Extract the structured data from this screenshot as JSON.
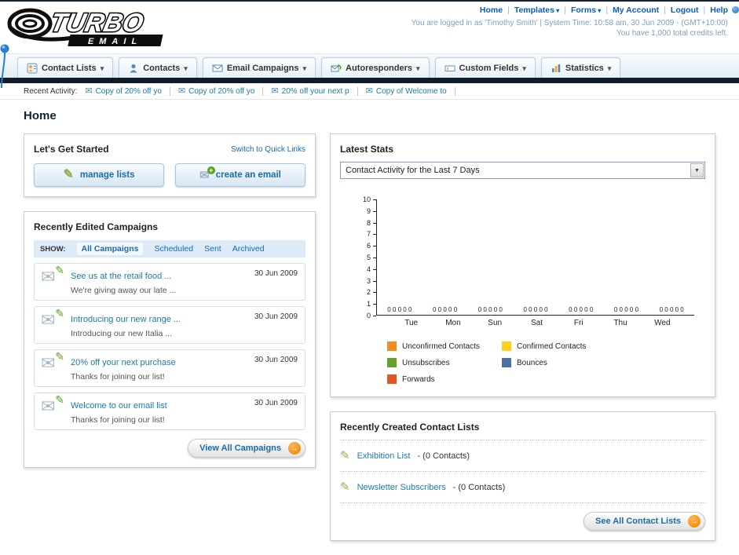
{
  "header": {
    "nav_links": [
      "Home",
      "Templates",
      "Forms",
      "My Account",
      "Logout",
      "Help"
    ],
    "login_info": "You are logged in as 'Timothy Smith' | System Time: 10:58 am, 30 Jun 2009 - (GMT+10:00)",
    "credits_info": "You have 1,000 total credits left.",
    "logo_main": "TURBO",
    "logo_sub": "EMAIL"
  },
  "main_nav": {
    "items": [
      {
        "label": "Contact Lists"
      },
      {
        "label": "Contacts"
      },
      {
        "label": "Email Campaigns"
      },
      {
        "label": "Autoresponders"
      },
      {
        "label": "Custom Fields"
      },
      {
        "label": "Statistics"
      }
    ]
  },
  "recent_activity": {
    "label": "Recent Activity:",
    "items": [
      "Copy of 20% off yo",
      "Copy of 20% off yo",
      "20% off your next p",
      "Copy of Welcome to"
    ]
  },
  "page_title": "Home",
  "get_started": {
    "title": "Let's Get Started",
    "switch_link": "Switch to Quick Links",
    "buttons": [
      {
        "label": "manage lists"
      },
      {
        "label": "create an email"
      }
    ]
  },
  "campaigns": {
    "title": "Recently Edited Campaigns",
    "show_label": "SHOW:",
    "filters": [
      "All Campaigns",
      "Scheduled",
      "Sent",
      "Archived"
    ],
    "active_filter": "All Campaigns",
    "items": [
      {
        "title": "See us at the retail food ...",
        "subtitle": "We're giving away our late ...",
        "date": "30 Jun 2009"
      },
      {
        "title": "Introducing our new range ...",
        "subtitle": "Introducing our new Italia ...",
        "date": "30 Jun 2009"
      },
      {
        "title": "20% off your next purchase",
        "subtitle": "Thanks for joining our list!",
        "date": "30 Jun 2009"
      },
      {
        "title": "Welcome to our email list",
        "subtitle": "Thanks for joining our list!",
        "date": "30 Jun 2009"
      }
    ],
    "view_all_label": "View All Campaigns"
  },
  "latest_stats": {
    "title": "Latest Stats",
    "dropdown_value": "Contact Activity for the Last 7 Days",
    "chart_data": {
      "type": "bar",
      "categories": [
        "Tue",
        "Mon",
        "Sun",
        "Sat",
        "Fri",
        "Thu",
        "Wed"
      ],
      "series": [
        {
          "name": "Unconfirmed Contacts",
          "color": "#F08C21",
          "values": [
            0,
            0,
            0,
            0,
            0,
            0,
            0
          ]
        },
        {
          "name": "Confirmed Contacts",
          "color": "#FDD020",
          "values": [
            0,
            0,
            0,
            0,
            0,
            0,
            0
          ]
        },
        {
          "name": "Unsubscribes",
          "color": "#63A32A",
          "values": [
            0,
            0,
            0,
            0,
            0,
            0,
            0
          ]
        },
        {
          "name": "Bounces",
          "color": "#4F6FA0",
          "values": [
            0,
            0,
            0,
            0,
            0,
            0,
            0
          ]
        },
        {
          "name": "Forwards",
          "color": "#E2571F",
          "values": [
            0,
            0,
            0,
            0,
            0,
            0,
            0
          ]
        }
      ],
      "title": "Contact Activity for the Last 7 Days",
      "xlabel": "",
      "ylabel": "",
      "ylim": [
        0,
        10
      ],
      "grid": false,
      "legend_position": "bottom"
    }
  },
  "contact_lists": {
    "title": "Recently Created Contact Lists",
    "items": [
      {
        "name": "Exhibition List",
        "detail": "- (0 Contacts)"
      },
      {
        "name": "Newsletter Subscribers",
        "detail": "- (0 Contacts)"
      }
    ],
    "see_all_label": "See All Contact Lists"
  }
}
